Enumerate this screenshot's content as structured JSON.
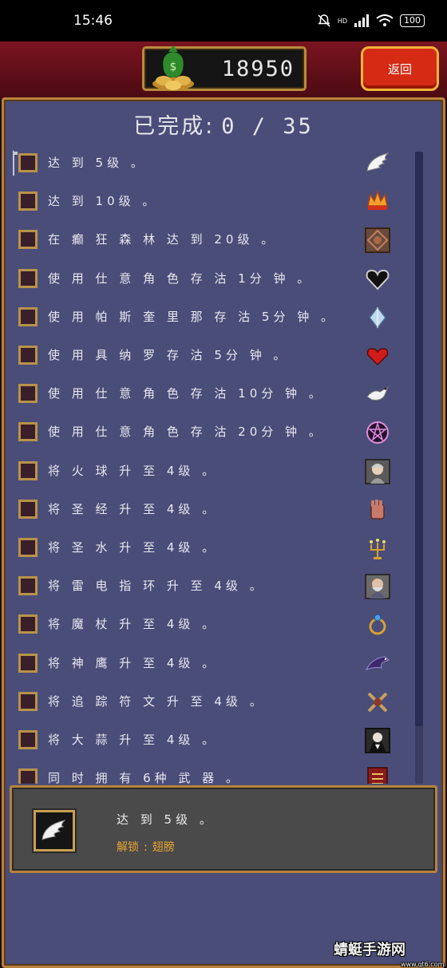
{
  "status_bar": {
    "time": "15:46",
    "network": "HD",
    "battery": "100"
  },
  "header": {
    "coins": "18950",
    "back_label": "返回"
  },
  "panel": {
    "completed_label": "已完成:",
    "completed_count": "0 / 35"
  },
  "achievements": [
    {
      "text": "达 到 5级 。",
      "icon": "wing-icon",
      "checked": false
    },
    {
      "text": "达 到 10级 。",
      "icon": "crown-icon",
      "checked": false
    },
    {
      "text": "在 癫 狂 森 林 达 到 20级 。",
      "icon": "forest-emblem-icon",
      "checked": false
    },
    {
      "text": "使 用 仕 意 角 色 存 沽 1分 钟 。",
      "icon": "black-heart-icon",
      "checked": false
    },
    {
      "text": "使 用 帕 斯 奎 里 那 存 沽 5分 钟 。",
      "icon": "crystal-icon",
      "checked": false
    },
    {
      "text": "使 用 具 纳 罗 存 沽 5分 钟 。",
      "icon": "red-heart-icon",
      "checked": false
    },
    {
      "text": "使 用 仕 意 角 色 存 沽 10分 钟 。",
      "icon": "dove-icon",
      "checked": false
    },
    {
      "text": "使 用 仕 意 角 色 存 沽 20分 钟 。",
      "icon": "pentagram-icon",
      "checked": false
    },
    {
      "text": "将 火 球 升 至 4级 。",
      "icon": "old-woman-portrait-icon",
      "checked": false
    },
    {
      "text": "将 圣 经 升 至 4级 。",
      "icon": "gauntlet-icon",
      "checked": false
    },
    {
      "text": "将 圣 水 升 至 4级 。",
      "icon": "candelabra-icon",
      "checked": false
    },
    {
      "text": "将 雷 电 指 环 升 至 4级 。",
      "icon": "old-man-portrait-icon",
      "checked": false
    },
    {
      "text": "将 魔 杖 升 至 4级 。",
      "icon": "ring-icon",
      "checked": false
    },
    {
      "text": "将 神 鹰 升 至 4级 。",
      "icon": "eagle-icon",
      "checked": false
    },
    {
      "text": "将 追 踪 符 文 升 至 4级 。",
      "icon": "crossed-weapons-icon",
      "checked": false
    },
    {
      "text": "将 大 蒜 升 至 4级 。",
      "icon": "vampire-portrait-icon",
      "checked": false
    },
    {
      "text": "同 时 拥 有 6种 武 器 。",
      "icon": "book-icon",
      "checked": false
    }
  ],
  "detail": {
    "text": "达 到 5级 。",
    "unlock_label": "解锁",
    "unlock_sep": ":",
    "unlock_value": "翅膀",
    "icon": "wing-icon"
  },
  "watermark": {
    "text": "蜻蜓手游网",
    "url": "www.qt6.com"
  },
  "colors": {
    "panel_bg": "#4a4d78",
    "frame_gold": "#b8823c",
    "back_button": "#d52a14",
    "unlock_text": "#e7a630"
  }
}
